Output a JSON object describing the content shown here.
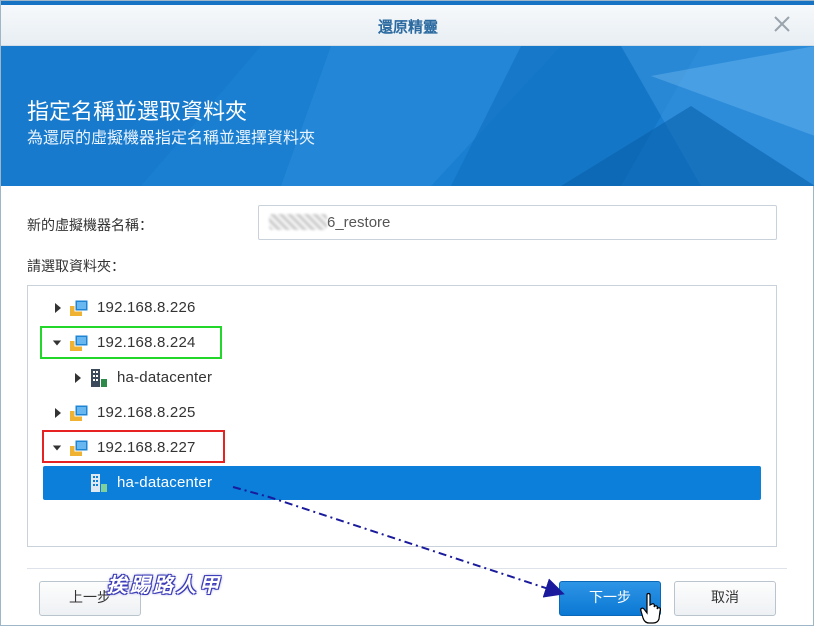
{
  "dialog": {
    "title": "還原精靈",
    "close_icon": "close-icon"
  },
  "banner": {
    "title": "指定名稱並選取資料夾",
    "subtitle": "為還原的虛擬機器指定名稱並選擇資料夾"
  },
  "form": {
    "vm_name_label": "新的虛擬機器名稱：",
    "vm_name_value_visible": "6_restore",
    "folder_label": "請選取資料夾："
  },
  "tree": {
    "nodes": [
      {
        "label": "192.168.8.226",
        "icon": "host-icon",
        "expanded": false
      },
      {
        "label": "192.168.8.224",
        "icon": "host-icon",
        "expanded": true,
        "highlight": "green"
      },
      {
        "label": "ha-datacenter",
        "icon": "datacenter-icon",
        "expanded": false
      },
      {
        "label": "192.168.8.225",
        "icon": "host-icon",
        "expanded": false
      },
      {
        "label": "192.168.8.227",
        "icon": "host-icon",
        "expanded": true,
        "highlight": "red"
      },
      {
        "label": "ha-datacenter",
        "icon": "datacenter-icon",
        "selected": true
      }
    ]
  },
  "buttons": {
    "back": "上一步",
    "next": "下一步",
    "cancel": "取消"
  },
  "watermark": "挨踢路人甲",
  "colors": {
    "accent": "#0b7fd9",
    "banner": "#1a7fd0",
    "highlight_green": "#23d72a",
    "highlight_red": "#e62222",
    "annotation_arrow": "#1a1a9c"
  }
}
